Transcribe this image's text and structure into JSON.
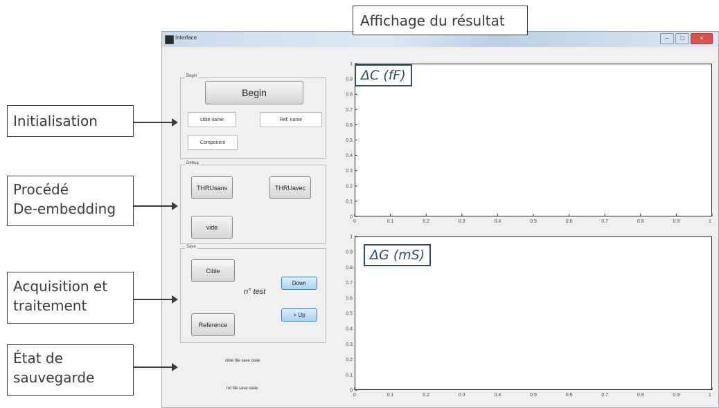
{
  "callouts": {
    "result_display": "Affichage du résultat",
    "initialisation": "Initialisation",
    "deembedding_line1": "Procédé",
    "deembedding_line2": "De-embedding",
    "acquisition_line1": "Acquisition et",
    "acquisition_line2": "traitement",
    "save_state_line1": "État de",
    "save_state_line2": "sauvegarde"
  },
  "window": {
    "title": "Interface",
    "controls": {
      "minimize": "–",
      "maximize": "□",
      "close": "×"
    }
  },
  "panels": {
    "begin": {
      "label": "Begin",
      "begin_button": "Begin",
      "cible_name_field": "cible name",
      "ref_name_field": "Ref. name",
      "component_field": "Component"
    },
    "deembedding": {
      "label": "Debug",
      "thru_sans_button": "THRUsans",
      "thru_avec_button": "THRUavec",
      "vide_button": "vide"
    },
    "save": {
      "label": "Save",
      "cible_button": "Cible",
      "reference_button": "Reference",
      "down_button": "Down",
      "up_button": "+ Up",
      "test_label": "n° test"
    },
    "status": {
      "cible_save_state": "cible file save state",
      "ref_save_state": "ref file save state"
    }
  },
  "plots": {
    "capacitance": {
      "quantity_label": "ΔC (fF)",
      "x_ticks": [
        "0",
        "0.1",
        "0.2",
        "0.3",
        "0.4",
        "0.5",
        "0.6",
        "0.7",
        "0.8",
        "0.9",
        "1"
      ],
      "y_ticks": [
        "0",
        "0.1",
        "0.2",
        "0.3",
        "0.4",
        "0.5",
        "0.6",
        "0.7",
        "0.8",
        "0.9",
        "1"
      ]
    },
    "conductance": {
      "quantity_label": "ΔG (mS)",
      "x_ticks": [
        "0",
        "0.1",
        "0.2",
        "0.3",
        "0.4",
        "0.5",
        "0.6",
        "0.7",
        "0.8",
        "0.9",
        "1"
      ],
      "y_ticks": [
        "0",
        "0.1",
        "0.2",
        "0.3",
        "0.4",
        "0.5",
        "0.6",
        "0.7",
        "0.8",
        "0.9",
        "1"
      ]
    }
  }
}
